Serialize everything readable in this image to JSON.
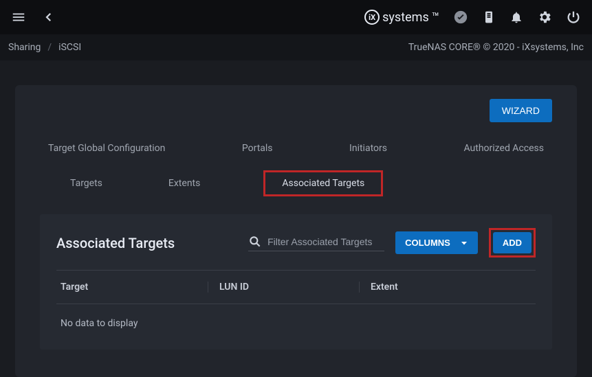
{
  "topbar": {
    "brand_prefix": "iX",
    "brand_text": "systems"
  },
  "breadcrumb": {
    "root": "Sharing",
    "current": "iSCSI",
    "copyright": "TrueNAS CORE® © 2020 - iXsystems, Inc"
  },
  "card": {
    "wizard_label": "WIZARD",
    "tabs_row1": {
      "t1": "Target Global Configuration",
      "t2": "Portals",
      "t3": "Initiators",
      "t4": "Authorized Access"
    },
    "tabs_row2": {
      "t1": "Targets",
      "t2": "Extents",
      "t3": "Associated Targets"
    }
  },
  "section": {
    "title": "Associated Targets",
    "search_placeholder": "Filter Associated Targets",
    "columns_label": "COLUMNS",
    "add_label": "ADD",
    "headers": {
      "c1": "Target",
      "c2": "LUN ID",
      "c3": "Extent"
    },
    "no_data": "No data to display"
  }
}
